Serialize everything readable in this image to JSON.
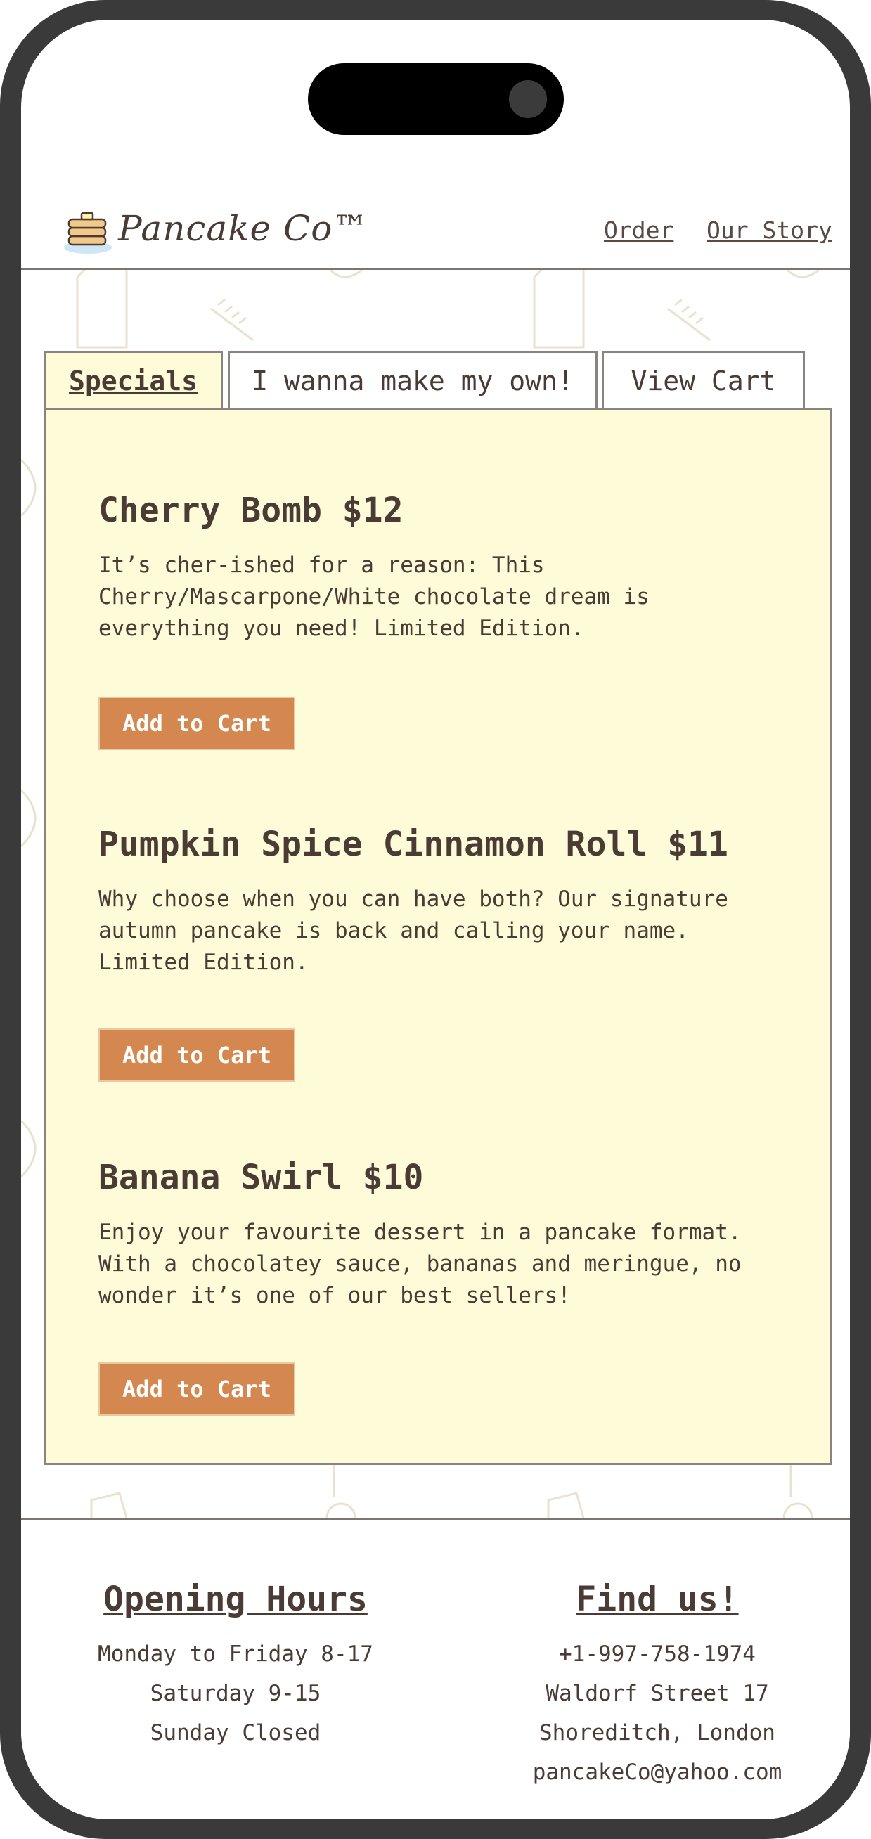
{
  "brand": {
    "name": "Pancake Co™"
  },
  "nav": {
    "order": "Order",
    "story": "Our Story"
  },
  "tabs": [
    "Specials",
    "I wanna make my own!",
    "View Cart"
  ],
  "specials": [
    {
      "title": "Cherry Bomb $12",
      "description": "It’s cher-ished for a reason: This Cherry/Mascarpone/White chocolate dream is everything you need! Limited Edition.",
      "button": "Add to Cart"
    },
    {
      "title": "Pumpkin Spice Cinnamon Roll $11",
      "description": "Why choose when you can have both? Our signature autumn pancake is back and calling your name. Limited Edition.",
      "button": "Add to Cart"
    },
    {
      "title": "Banana Swirl $10",
      "description": "Enjoy your favourite dessert in a pancake format. With a chocolatey sauce, bananas and meringue, no wonder it’s one of our best sellers!",
      "button": "Add to Cart"
    }
  ],
  "footer": {
    "hours": {
      "title": "Opening Hours",
      "lines": [
        "Monday to Friday 8-17",
        "Saturday 9-15",
        "Sunday Closed"
      ]
    },
    "contact": {
      "title": "Find us!",
      "lines": [
        "+1-997-758-1974",
        "Waldorf Street 17",
        "Shoreditch, London",
        "pancakeCo@yahoo.com"
      ]
    }
  },
  "colors": {
    "panel": "#fdfbd8",
    "button": "#d4884f",
    "text": "#4a3b35",
    "frame": "#3a3a3a"
  }
}
